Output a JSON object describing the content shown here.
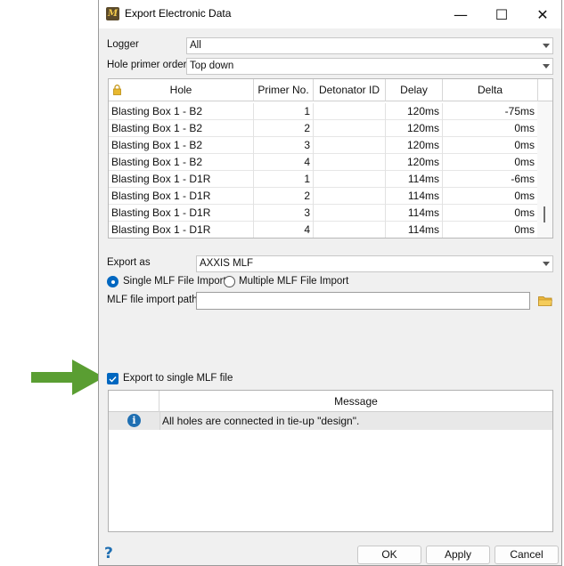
{
  "window": {
    "title": "Export Electronic Data",
    "controls": {
      "minimize": "—",
      "maximize": "☐",
      "close": "✕"
    }
  },
  "form": {
    "logger_label": "Logger",
    "logger_value": "All",
    "hole_primer_order_label": "Hole primer order",
    "hole_primer_order_value": "Top down"
  },
  "table": {
    "columns": [
      "Hole",
      "Primer No.",
      "Detonator ID",
      "Delay",
      "Delta"
    ],
    "rows": [
      [
        "Blasting Box 1 - B2",
        "1",
        "",
        "120ms",
        "-75ms"
      ],
      [
        "Blasting Box 1 - B2",
        "2",
        "",
        "120ms",
        "0ms"
      ],
      [
        "Blasting Box 1 - B2",
        "3",
        "",
        "120ms",
        "0ms"
      ],
      [
        "Blasting Box 1 - B2",
        "4",
        "",
        "120ms",
        "0ms"
      ],
      [
        "Blasting Box 1 - D1R",
        "1",
        "",
        "114ms",
        "-6ms"
      ],
      [
        "Blasting Box 1 - D1R",
        "2",
        "",
        "114ms",
        "0ms"
      ],
      [
        "Blasting Box 1 - D1R",
        "3",
        "",
        "114ms",
        "0ms"
      ],
      [
        "Blasting Box 1 - D1R",
        "4",
        "",
        "114ms",
        "0ms"
      ]
    ]
  },
  "export": {
    "export_as_label": "Export as",
    "export_as_value": "AXXIS MLF",
    "single_option": "Single MLF File Import",
    "multiple_option": "Multiple MLF File Import",
    "selected_option": "single",
    "path_label": "MLF file import path",
    "path_value": "",
    "single_file_checkbox_label": "Export to single MLF file",
    "single_file_checked": true
  },
  "messages": {
    "header": "Message",
    "rows": [
      {
        "icon": "info-icon",
        "text": "All holes are connected in tie-up \"design\"."
      }
    ]
  },
  "buttons": {
    "ok": "OK",
    "apply": "Apply",
    "cancel": "Cancel",
    "help": "?"
  },
  "colors": {
    "accent": "#0067c0",
    "arrow": "#5a9e32",
    "info": "#1f6fb2"
  },
  "annotation": {
    "icon": "green-arrow-icon"
  }
}
